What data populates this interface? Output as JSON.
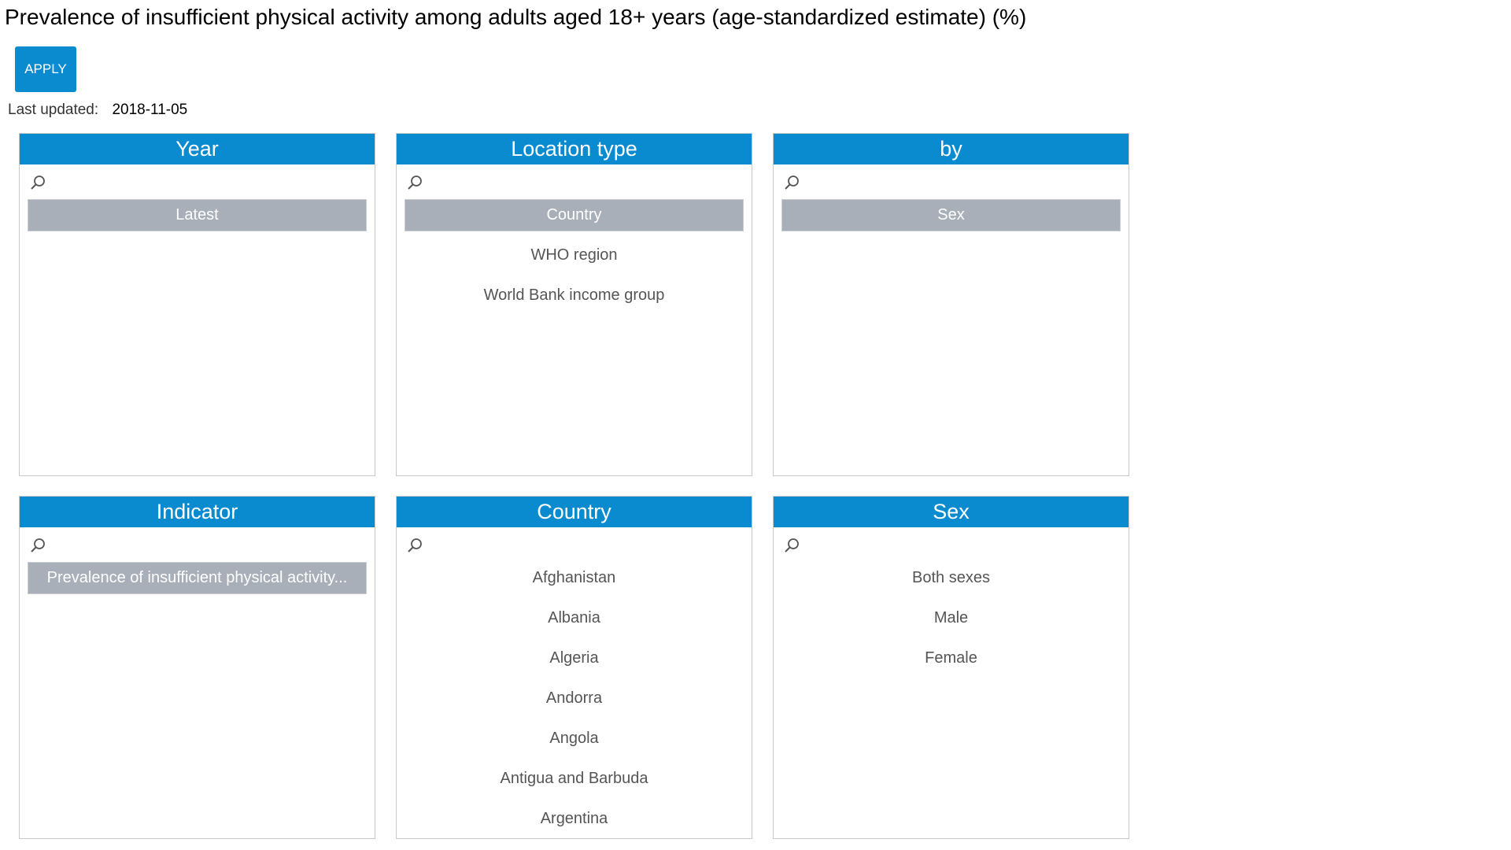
{
  "page": {
    "title": "Prevalence of insufficient physical activity among adults aged 18+ years (age-standardized estimate) (%)"
  },
  "apply_button": {
    "label": "APPLY"
  },
  "last_updated": {
    "label": "Last updated:",
    "value": "2018-11-05"
  },
  "colors": {
    "accent": "#0a8bd0",
    "selected_bg": "#a9afb8"
  },
  "panels": {
    "year": {
      "header": "Year",
      "search_icon": "search-icon",
      "search_placeholder": "",
      "items": [
        {
          "label": "Latest",
          "selected": true
        }
      ]
    },
    "location_type": {
      "header": "Location type",
      "search_icon": "search-icon",
      "search_placeholder": "",
      "items": [
        {
          "label": "Country",
          "selected": true
        },
        {
          "label": "WHO region",
          "selected": false
        },
        {
          "label": "World Bank income group",
          "selected": false
        }
      ]
    },
    "by": {
      "header": "by",
      "search_icon": "search-icon",
      "search_placeholder": "",
      "items": [
        {
          "label": "Sex",
          "selected": true
        }
      ]
    },
    "indicator": {
      "header": "Indicator",
      "search_icon": "search-icon",
      "search_placeholder": "",
      "items": [
        {
          "label": "Prevalence of insufficient physical activity...",
          "selected": true
        }
      ]
    },
    "country": {
      "header": "Country",
      "search_icon": "search-icon",
      "search_placeholder": "",
      "items": [
        {
          "label": "Afghanistan",
          "selected": false
        },
        {
          "label": "Albania",
          "selected": false
        },
        {
          "label": "Algeria",
          "selected": false
        },
        {
          "label": "Andorra",
          "selected": false
        },
        {
          "label": "Angola",
          "selected": false
        },
        {
          "label": "Antigua and Barbuda",
          "selected": false
        },
        {
          "label": "Argentina",
          "selected": false
        }
      ]
    },
    "sex": {
      "header": "Sex",
      "search_icon": "search-icon",
      "search_placeholder": "",
      "items": [
        {
          "label": "Both sexes",
          "selected": false
        },
        {
          "label": "Male",
          "selected": false
        },
        {
          "label": "Female",
          "selected": false
        }
      ]
    }
  }
}
